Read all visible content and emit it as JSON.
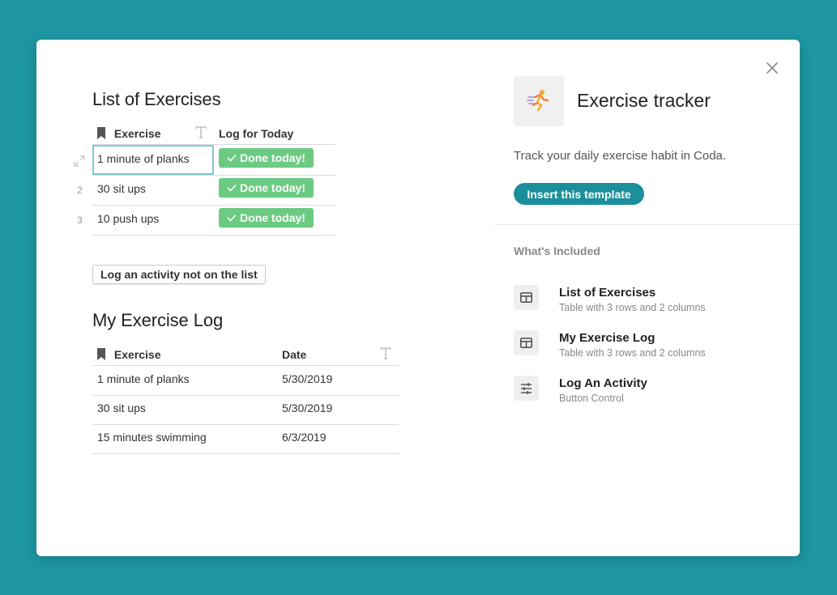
{
  "list_of_exercises": {
    "title": "List of Exercises",
    "columns": [
      "Exercise",
      "Log for Today"
    ],
    "rows": [
      {
        "num": "",
        "exercise": "1 minute of planks",
        "button": "Done today!"
      },
      {
        "num": "2",
        "exercise": "30 sit ups",
        "button": "Done today!"
      },
      {
        "num": "3",
        "exercise": "10 push ups",
        "button": "Done today!"
      }
    ]
  },
  "log_activity_button": "Log an activity not on the list",
  "exercise_log": {
    "title": "My Exercise Log",
    "columns": [
      "Exercise",
      "Date"
    ],
    "rows": [
      {
        "exercise": "1 minute of planks",
        "date": "5/30/2019"
      },
      {
        "exercise": "30 sit ups",
        "date": "5/30/2019"
      },
      {
        "exercise": "15 minutes swimming",
        "date": "6/3/2019"
      }
    ]
  },
  "template": {
    "title": "Exercise tracker",
    "description": "Track your daily exercise habit in Coda.",
    "insert_button": "Insert this template",
    "included_heading": "What's Included",
    "included": [
      {
        "icon": "table-icon",
        "title": "List of Exercises",
        "subtitle": "Table with 3 rows and 2 columns"
      },
      {
        "icon": "table-icon",
        "title": "My Exercise Log",
        "subtitle": "Table with 3 rows and 2 columns"
      },
      {
        "icon": "sliders-icon",
        "title": "Log An Activity",
        "subtitle": "Button Control"
      }
    ]
  },
  "colors": {
    "background": "#1e96a3",
    "done_button": "#6ccb82",
    "insert_button": "#1b8f9b",
    "selected_cell": "#7fc9d4"
  }
}
